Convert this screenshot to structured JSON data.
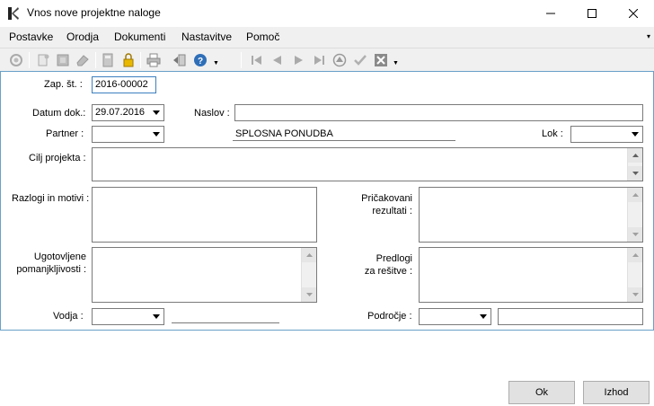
{
  "window": {
    "title": "Vnos nove projektne naloge"
  },
  "menu": {
    "items": [
      "Postavke",
      "Orodja",
      "Dokumenti",
      "Nastavitve",
      "Pomoč"
    ],
    "more": "▾"
  },
  "form": {
    "zap_st_label": "Zap. št. :",
    "zap_st_value": "2016-00002",
    "datum_label": "Datum dok.:",
    "datum_value": "29.07.2016",
    "naslov_label": "Naslov :",
    "naslov_value": "",
    "partner_label": "Partner :",
    "partner_value": "",
    "partner_name": "SPLOSNA PONUDBA",
    "lok_label": "Lok :",
    "lok_value": "",
    "cilj_label": "Cilj projekta :",
    "razlogi_label": "Razlogi in motivi :",
    "pricakovani_label_1": "Pričakovani",
    "pricakovani_label_2": "rezultati :",
    "ugotovljene_label_1": "Ugotovljene",
    "ugotovljene_label_2": "pomanjkljivosti :",
    "predlogi_label_1": "Predlogi",
    "predlogi_label_2": "za rešitve :",
    "vodja_label": "Vodja :",
    "vodja_value": "",
    "podrocje_label": "Področje :",
    "podrocje_value": ""
  },
  "buttons": {
    "ok": "Ok",
    "izhod": "Izhod"
  },
  "colors": {
    "panel_border": "#6aa0c8",
    "focus_border": "#3d7fbf",
    "toolbar_bg": "#f0f0f0"
  }
}
